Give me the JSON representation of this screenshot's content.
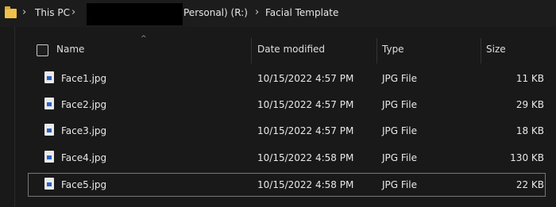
{
  "address": {
    "crumbs": [
      "This PC",
      "Personal) (R:)",
      "Facial Template"
    ],
    "folder_icon": "folder-icon",
    "separator_icon": "chevron-right-icon"
  },
  "columns": {
    "name": "Name",
    "date": "Date modified",
    "type": "Type",
    "size": "Size"
  },
  "files": [
    {
      "name": "Face1.jpg",
      "date": "10/15/2022 4:57 PM",
      "type": "JPG File",
      "size": "11 KB"
    },
    {
      "name": "Face2.jpg",
      "date": "10/15/2022 4:57 PM",
      "type": "JPG File",
      "size": "29 KB"
    },
    {
      "name": "Face3.jpg",
      "date": "10/15/2022 4:57 PM",
      "type": "JPG File",
      "size": "18 KB"
    },
    {
      "name": "Face4.jpg",
      "date": "10/15/2022 4:58 PM",
      "type": "JPG File",
      "size": "130 KB"
    },
    {
      "name": "Face5.jpg",
      "date": "10/15/2022 4:58 PM",
      "type": "JPG File",
      "size": "22 KB"
    }
  ],
  "selected_file": "Face5.jpg",
  "colors": {
    "background": "#191919",
    "folder": "#f0c04a",
    "file_icon_accent": "#2a64c8"
  }
}
